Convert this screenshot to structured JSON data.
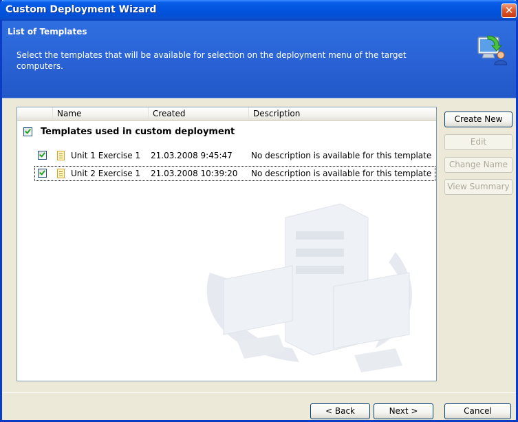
{
  "window": {
    "title": "Custom Deployment Wizard",
    "close_glyph": "✕"
  },
  "header": {
    "title": "List of Templates",
    "description": "Select the templates that will be available for selection on the deployment menu of the target computers.",
    "icon": "computer-user-arrow-icon"
  },
  "list": {
    "columns": {
      "name": "Name",
      "created": "Created",
      "description": "Description"
    },
    "group": {
      "label": "Templates used in custom deployment",
      "checked": true
    },
    "items": [
      {
        "name": "Unit 1 Exercise 1",
        "created": "21.03.2008 9:45:47",
        "description": "No description is available for this template",
        "checked": true
      },
      {
        "name": "Unit 2 Exercise 1",
        "created": "21.03.2008 10:39:20",
        "description": "No description is available for this template",
        "checked": true
      }
    ]
  },
  "side_buttons": {
    "create_new": "Create New",
    "edit": "Edit",
    "change_name": "Change Name",
    "view_summary": "View Summary"
  },
  "footer": {
    "back": "< Back",
    "next": "Next >",
    "cancel": "Cancel"
  },
  "colors": {
    "titlebar": "#0356e0",
    "header": "#2a63d6",
    "check": "#21a121"
  }
}
